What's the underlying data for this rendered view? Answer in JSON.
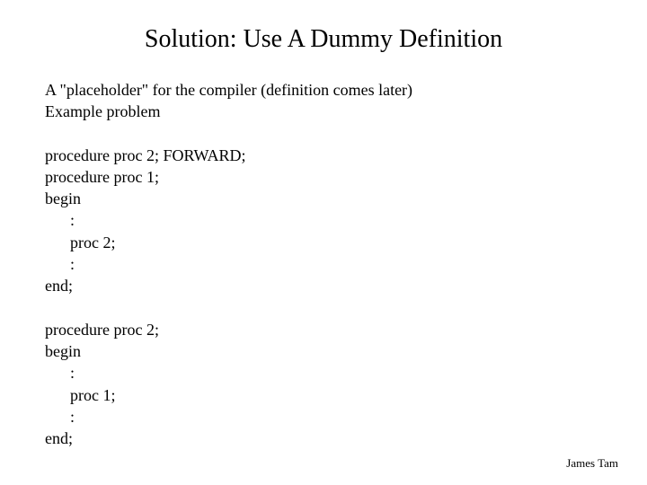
{
  "title": "Solution: Use A Dummy Definition",
  "intro_line1": "A \"placeholder\" for the compiler (definition comes later)",
  "intro_line2": "Example problem",
  "block1": {
    "l1": "procedure proc 2; FORWARD;",
    "l2": "procedure proc 1;",
    "l3": "begin",
    "l4": ":",
    "l5": "proc 2;",
    "l6": ":",
    "l7": "end;"
  },
  "block2": {
    "l1": "procedure proc 2;",
    "l2": "begin",
    "l3": ":",
    "l4": "proc 1;",
    "l5": ":",
    "l6": "end;"
  },
  "footer": "James Tam"
}
